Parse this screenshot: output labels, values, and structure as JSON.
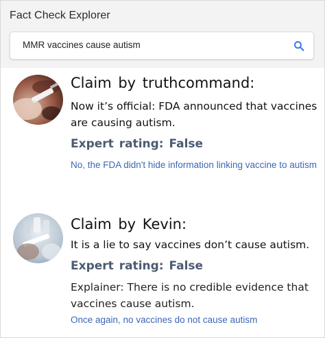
{
  "app": {
    "title": "Fact Check Explorer"
  },
  "search": {
    "query": "MMR vaccines cause autism",
    "icon": "search-icon",
    "icon_color": "#3b78e7"
  },
  "results": [
    {
      "avatar": "vaccine-syringe-photo",
      "claim_title": "Claim  by  truthcommand:",
      "claim_text": "Now it’s official: FDA announced that vaccines are causing autism.",
      "rating": "Expert  rating:  False",
      "link_text": "No, the FDA didn't hide information linking vaccine to autism"
    },
    {
      "avatar": "vaccine-vial-photo",
      "claim_title": "Claim  by  Kevin:",
      "claim_text": "It is a lie to say vaccines don’t cause autism.",
      "rating": "Expert  rating:  False",
      "explainer": "Explainer:  There is no credible evidence that vaccines cause autism.",
      "link_text": "Once again, no vaccines do not cause autism"
    }
  ],
  "colors": {
    "rating": "#4b5b72",
    "link": "#3b67b8",
    "header_bg": "#f3f3f3"
  }
}
